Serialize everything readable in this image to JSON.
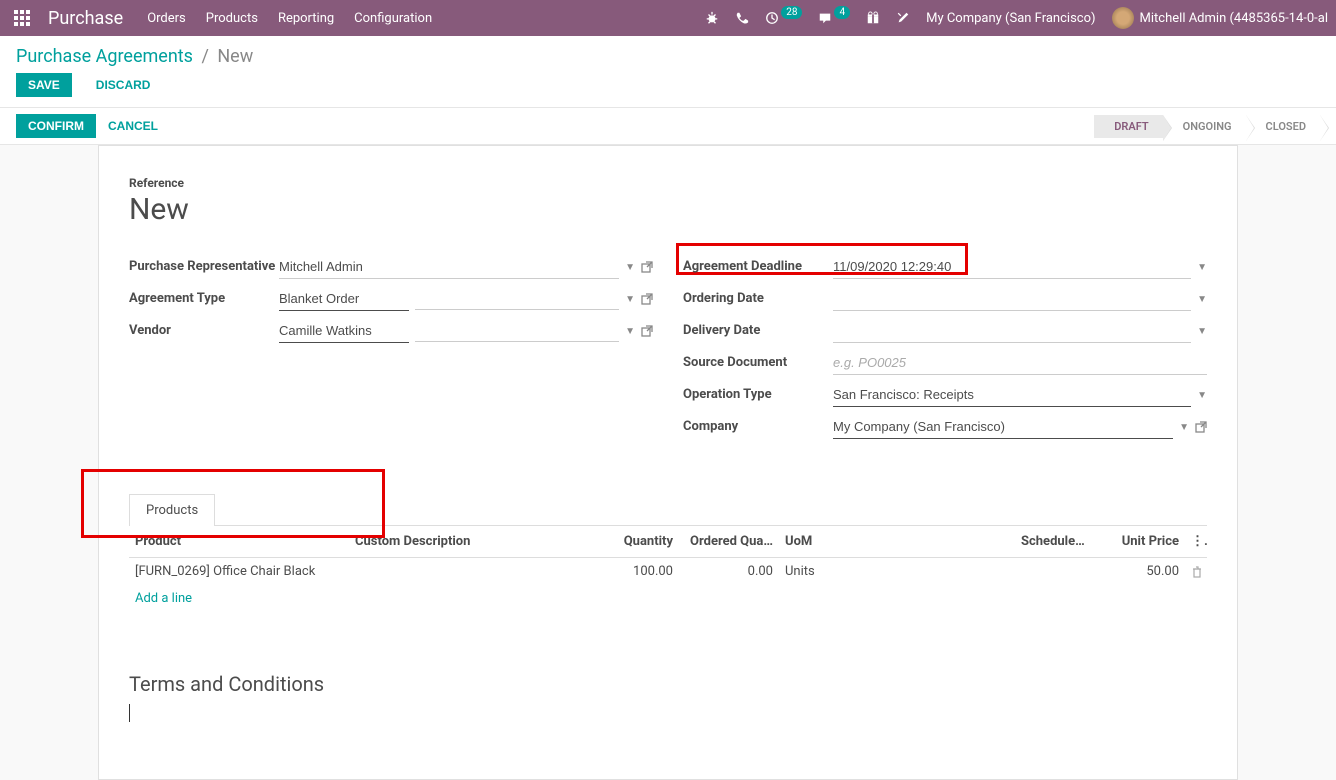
{
  "nav": {
    "app": "Purchase",
    "menu": [
      "Orders",
      "Products",
      "Reporting",
      "Configuration"
    ],
    "activities_badge": "28",
    "messages_badge": "4",
    "company": "My Company (San Francisco)",
    "user": "Mitchell Admin (4485365-14-0-al"
  },
  "breadcrumb": {
    "parent": "Purchase Agreements",
    "current": "New"
  },
  "buttons": {
    "save": "SAVE",
    "discard": "DISCARD",
    "confirm": "CONFIRM",
    "cancel": "CANCEL"
  },
  "status": {
    "draft": "DRAFT",
    "ongoing": "ONGOING",
    "closed": "CLOSED"
  },
  "form": {
    "reference_label": "Reference",
    "reference_value": "New",
    "left": {
      "purchase_rep_label": "Purchase Representative",
      "purchase_rep_value": "Mitchell Admin",
      "agreement_type_label": "Agreement Type",
      "agreement_type_value": "Blanket Order",
      "vendor_label": "Vendor",
      "vendor_value": "Camille Watkins"
    },
    "right": {
      "deadline_label": "Agreement Deadline",
      "deadline_value": "11/09/2020 12:29:40",
      "ordering_label": "Ordering Date",
      "ordering_value": "",
      "delivery_label": "Delivery Date",
      "delivery_value": "",
      "source_label": "Source Document",
      "source_placeholder": "e.g. PO0025",
      "optype_label": "Operation Type",
      "optype_value": "San Francisco: Receipts",
      "company_label": "Company",
      "company_value": "My Company (San Francisco)"
    }
  },
  "tabs": {
    "products": "Products"
  },
  "table": {
    "headers": {
      "product": "Product",
      "custom_desc": "Custom Description",
      "quantity": "Quantity",
      "ordered": "Ordered Qua…",
      "uom": "UoM",
      "scheduled": "Scheduled …",
      "unit_price": "Unit Price"
    },
    "rows": [
      {
        "product": "[FURN_0269] Office Chair Black",
        "custom_desc": "",
        "quantity": "100.00",
        "ordered": "0.00",
        "uom": "Units",
        "scheduled": "",
        "unit_price": "50.00"
      }
    ],
    "add_line": "Add a line"
  },
  "terms": {
    "heading": "Terms and Conditions"
  }
}
